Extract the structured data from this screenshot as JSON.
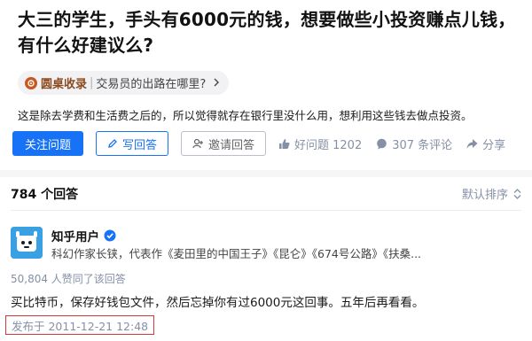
{
  "question": {
    "title": "大三的学生，手头有6000元的钱，想要做些小投资赚点儿钱，有什么好建议么?",
    "roundtable_label": "圆桌收录",
    "roundtable_separator": "|",
    "roundtable_topic": "交易员的出路在哪里?",
    "description": "这是除去学费和生活费之后的，所以觉得就存在银行里没什么用，想利用这些钱去做点投资。"
  },
  "actions": {
    "follow_label": "关注问题",
    "write_answer_label": "写回答",
    "invite_label": "邀请回答",
    "good_question_label": "好问题 1202",
    "comments_label": "307 条评论",
    "share_label": "分享"
  },
  "answers": {
    "count_label": "784 个回答",
    "sort_label": "默认排序"
  },
  "answer": {
    "author_name": "知乎用户",
    "author_bio": "科幻作家长铗，代表作《麦田里的中国王子》《昆仑》《674号公路》《扶桑...",
    "voters": "50,804 人赞同了该回答",
    "content": "买比特币，保存好钱包文件，然后忘掉你有过6000元这回事。五年后再看看。",
    "publish_time": "发布于 2011-12-21 12:48"
  },
  "colors": {
    "primary": "#1772f6",
    "meta": "#8590a6",
    "highlight_border": "#d43a3a",
    "roundtable": "#c8571e"
  },
  "icons": [
    "roundtable-icon",
    "pencil-icon",
    "person-add-icon",
    "thumbs-up-icon",
    "comment-icon",
    "share-icon",
    "sort-icon",
    "verified-icon",
    "chevron-right-icon"
  ]
}
